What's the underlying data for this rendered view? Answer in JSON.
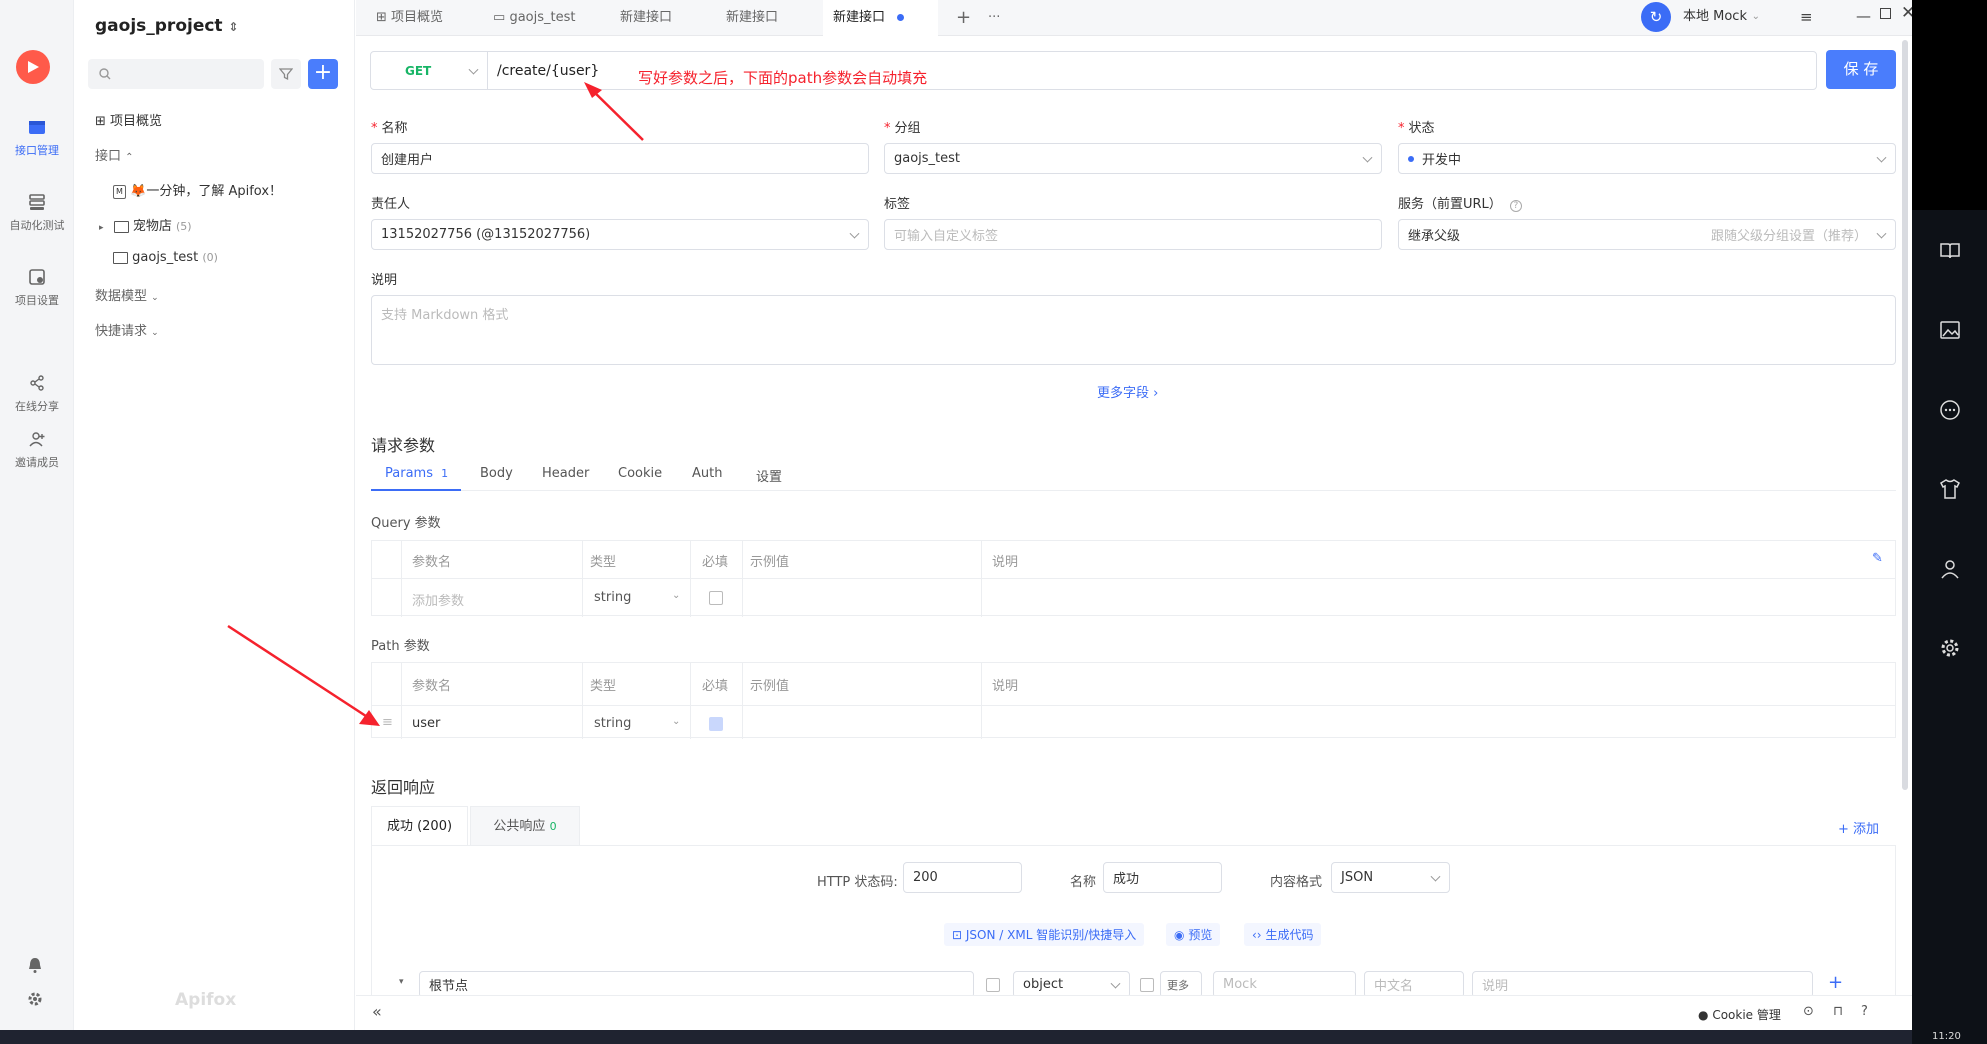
{
  "rail": {
    "items": [
      {
        "label": "接口管理",
        "icon": "api-icon"
      },
      {
        "label": "自动化测试",
        "icon": "autotest-icon"
      },
      {
        "label": "项目设置",
        "icon": "settings-icon"
      },
      {
        "label": "在线分享",
        "icon": "share-icon"
      },
      {
        "label": "邀请成员",
        "icon": "invite-icon"
      }
    ]
  },
  "sidebar": {
    "project": "gaojs_project",
    "overview": "项目概览",
    "api_section": "接口",
    "items": [
      {
        "label": "🦊一分钟，了解 Apifox！",
        "count": ""
      },
      {
        "label": "宠物店",
        "count": "(5)"
      },
      {
        "label": "gaojs_test",
        "count": "(0)"
      }
    ],
    "data_model": "数据模型",
    "quick_request": "快捷请求",
    "watermark": "Apifox"
  },
  "tabs": [
    {
      "label": "项目概览"
    },
    {
      "label": "gaojs_test"
    },
    {
      "label": "新建接口"
    },
    {
      "label": "新建接口"
    },
    {
      "label": "新建接口"
    }
  ],
  "toolbar": {
    "env": "本地 Mock"
  },
  "request": {
    "method": "GET",
    "url": "/create/{user}",
    "save": "保 存",
    "annotation": "写好参数之后，下面的path参数会自动填充"
  },
  "form": {
    "name_label": "名称",
    "name_value": "创建用户",
    "group_label": "分组",
    "group_value": "gaojs_test",
    "status_label": "状态",
    "status_value": "开发中",
    "owner_label": "责任人",
    "owner_value": "13152027756 (@13152027756)",
    "tag_label": "标签",
    "tag_placeholder": "可输入自定义标签",
    "service_label": "服务（前置URL）",
    "service_value": "继承父级",
    "service_hint": "跟随父级分组设置（推荐）",
    "desc_label": "说明",
    "desc_placeholder": "支持 Markdown 格式",
    "more_fields": "更多字段 ›"
  },
  "params": {
    "title": "请求参数",
    "tabs": [
      {
        "label": "Params",
        "badge": "1"
      },
      {
        "label": "Body",
        "badge": ""
      },
      {
        "label": "Header",
        "badge": ""
      },
      {
        "label": "Cookie",
        "badge": ""
      },
      {
        "label": "Auth",
        "badge": ""
      },
      {
        "label": "设置",
        "badge": ""
      }
    ],
    "query_title": "Query 参数",
    "path_title": "Path 参数",
    "columns": [
      "参数名",
      "类型",
      "必填",
      "示例值",
      "说明"
    ],
    "query_row": {
      "name_placeholder": "添加参数",
      "type": "string"
    },
    "path_row": {
      "name": "user",
      "type": "string"
    }
  },
  "response": {
    "title": "返回响应",
    "tabs": [
      {
        "label": "成功 (200)",
        "badge": ""
      },
      {
        "label": "公共响应",
        "badge": "0"
      }
    ],
    "add": "+ 添加",
    "status_label": "HTTP 状态码:",
    "status_value": "200",
    "name_label": "名称",
    "name_value": "成功",
    "format_label": "内容格式",
    "format_value": "JSON",
    "import": "JSON / XML 智能识别/快捷导入",
    "preview": "预览",
    "gen_code": "生成代码",
    "root": "根节点",
    "root_type": "object",
    "more": "更多",
    "mock_placeholder": "Mock",
    "cn_placeholder": "中文名",
    "desc_placeholder": "说明"
  },
  "footer": {
    "cookie": "Cookie 管理"
  },
  "clock": "11:20"
}
